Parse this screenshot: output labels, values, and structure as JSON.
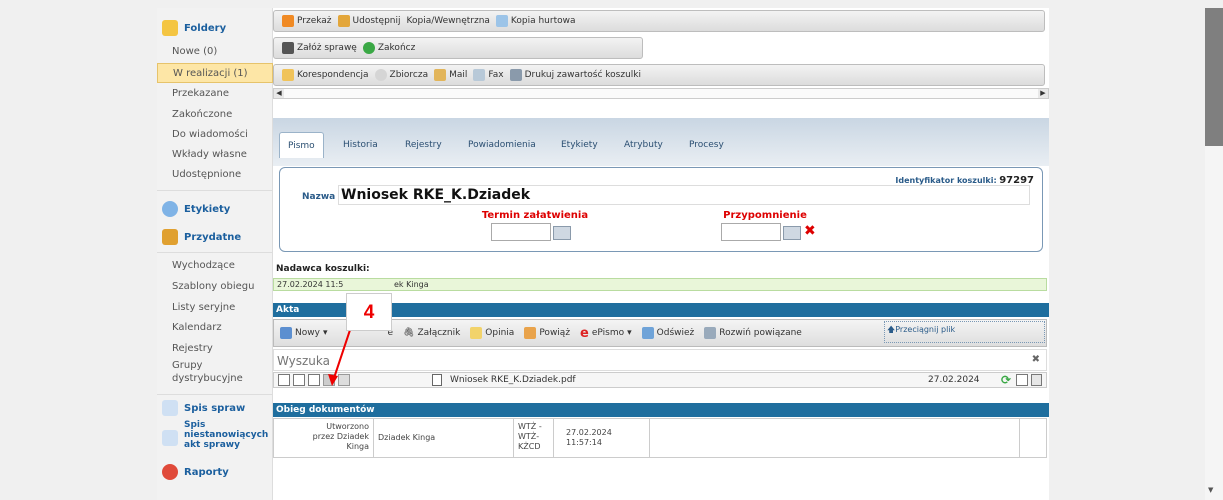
{
  "sidebar": {
    "folders_label": "Foldery",
    "items": [
      "Nowe (0)",
      "W realizacji (1)",
      "Przekazane",
      "Zakończone",
      "Do wiadomości",
      "Wkłady własne",
      "Udostępnione"
    ],
    "labels_label": "Etykiety",
    "useful_label": "Przydatne",
    "useful_items": [
      "Wychodzące",
      "Szablony obiegu",
      "Listy seryjne",
      "Kalendarz",
      "Rejestry",
      "Grupy dystrybucyjne"
    ],
    "cases_label": "Spis spraw",
    "noncase_label": "Spis niestanowiących akt sprawy",
    "reports_label": "Raporty"
  },
  "toolbars": {
    "row1": [
      "Przekaż",
      "Udostępnij",
      "Kopia/Wewnętrzna",
      "Kopia hurtowa"
    ],
    "row2": [
      "Załóż sprawę",
      "Zakończ"
    ],
    "row3": [
      "Korespondencja",
      "Zbiorcza",
      "Mail",
      "Fax",
      "Drukuj zawartość koszulki"
    ]
  },
  "tabs": [
    "Pismo",
    "Historia",
    "Rejestry",
    "Powiadomienia",
    "Etykiety",
    "Atrybuty",
    "Procesy"
  ],
  "card": {
    "id_label": "Identyfikator koszulki:",
    "id_value": "97297",
    "name_label": "Nazwa",
    "name_value": "Wniosek RKE_K.Dziadek",
    "deadline_label": "Termin załatwienia",
    "reminder_label": "Przypomnienie"
  },
  "sender": {
    "label": "Nadawca koszulki:",
    "value_left": "27.02.2024 11:5",
    "value_right": "ek Kinga"
  },
  "akta": {
    "title": "Akta",
    "toolbar": [
      "Nowy",
      "e",
      "Załącznik",
      "Opinia",
      "Powiąż",
      "ePismo",
      "Odśwież",
      "Rozwiń powiązane"
    ],
    "drag_label": "Przeciągnij plik",
    "search_placeholder": "Wyszuka",
    "file_name": "Wniosek RKE_K.Dziadek.pdf",
    "file_date": "27.02.2024"
  },
  "obieg": {
    "title": "Obieg dokumentów",
    "created": "Utworzono przez Dziadek Kinga",
    "user": "Dziadek Kinga",
    "unit": "WTŻ - WTŻ-KŻCD",
    "date": "27.02.2024 11:57:14"
  },
  "annotation": {
    "number": "4",
    "color": "#e00000"
  },
  "colors": {
    "accent": "#1f6e9e",
    "active_folder": "#fde6a6",
    "required_red": "#dd0000"
  }
}
